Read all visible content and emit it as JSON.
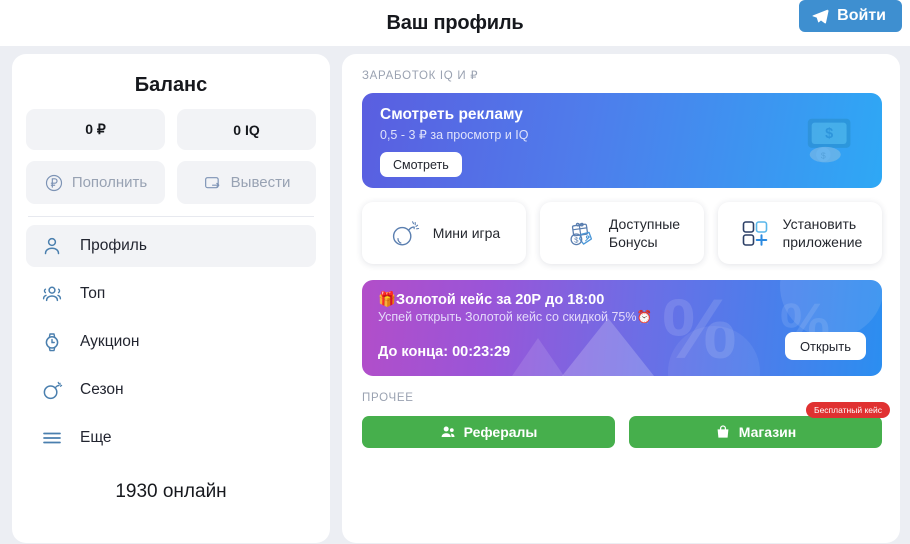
{
  "header": {
    "title": "Ваш профиль",
    "login_label": "Войти",
    "login_icon": "telegram-plane-icon"
  },
  "sidebar": {
    "balance_title": "Баланс",
    "balances": [
      {
        "value": "0 ₽"
      },
      {
        "value": "0 IQ"
      }
    ],
    "actions": [
      {
        "label": "Пополнить",
        "icon": "ruble-circle-icon"
      },
      {
        "label": "Вывести",
        "icon": "wallet-withdraw-icon"
      }
    ],
    "nav": [
      {
        "label": "Профиль",
        "icon": "user-icon",
        "active": true
      },
      {
        "label": "Топ",
        "icon": "users-group-icon",
        "active": false
      },
      {
        "label": "Аукцион",
        "icon": "watch-clock-icon",
        "active": false
      },
      {
        "label": "Сезон",
        "icon": "bomb-icon",
        "active": false
      },
      {
        "label": "Еще",
        "icon": "hamburger-menu-icon",
        "active": false
      }
    ],
    "online": "1930 онлайн"
  },
  "main": {
    "earn_section_label": "ЗАРАБОТОК IQ И ₽",
    "ad": {
      "title": "Смотреть рекламу",
      "subtitle": "0,5 - 3 ₽ за просмотр и IQ",
      "button": "Смотреть",
      "icon": "money-cash-icon"
    },
    "cards": [
      {
        "label": "Мини игра",
        "icon": "bomb-icon"
      },
      {
        "label": "Доступные\nБонусы",
        "line1": "Доступные",
        "line2": "Бонусы",
        "icon": "gift-discount-icon"
      },
      {
        "label": "Установить\nприложение",
        "line1": "Установить",
        "line2": "приложение",
        "icon": "app-install-icon"
      }
    ],
    "case": {
      "title": "🎁Золотой кейс за 20Р до 18:00",
      "subtitle": "Успей открыть Золотой кейс со скидкой 75%⏰",
      "timer": "До конца: 00:23:29",
      "button": "Открыть"
    },
    "other_section_label": "ПРОЧЕЕ",
    "green_buttons": [
      {
        "label": "Рефералы",
        "icon": "referrals-icon",
        "badge": null
      },
      {
        "label": "Магазин",
        "icon": "shop-bag-icon",
        "badge": "Бесплатный кейс"
      }
    ]
  },
  "colors": {
    "accent_blue": "#3e8fd0",
    "green": "#46af4c",
    "red_badge": "#e03131",
    "page_bg": "#eceef3",
    "muted_text": "#98a2b3"
  }
}
